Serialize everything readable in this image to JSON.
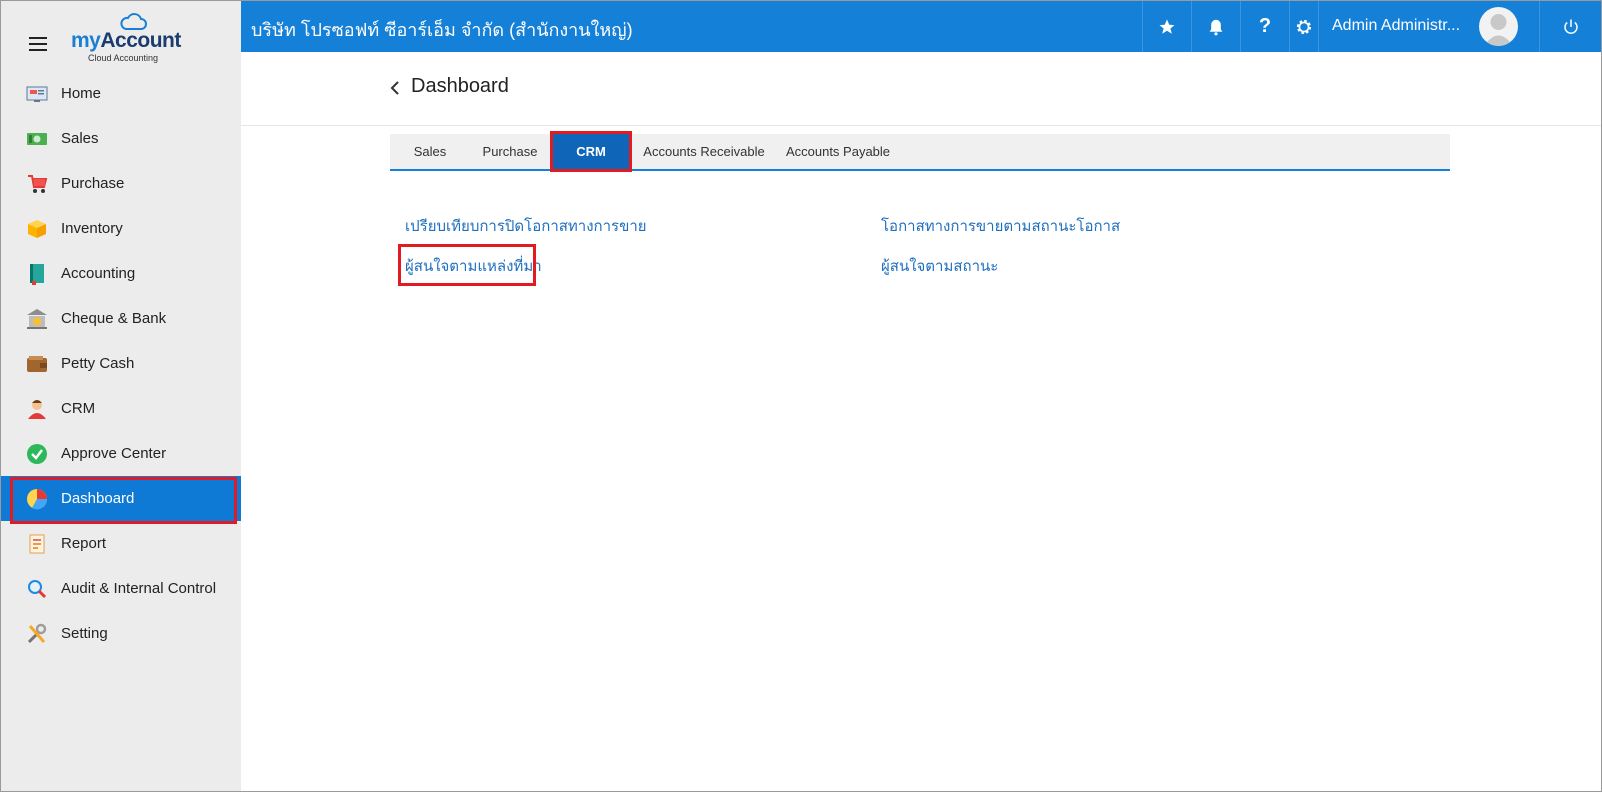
{
  "sidebar": {
    "logo_my": "my",
    "logo_account": "Account",
    "logo_sub": "Cloud Accounting",
    "items": [
      {
        "label": "Home",
        "icon": "home-icon"
      },
      {
        "label": "Sales",
        "icon": "sales-icon"
      },
      {
        "label": "Purchase",
        "icon": "cart-icon"
      },
      {
        "label": "Inventory",
        "icon": "box-icon"
      },
      {
        "label": "Accounting",
        "icon": "book-icon"
      },
      {
        "label": "Cheque & Bank",
        "icon": "bank-icon"
      },
      {
        "label": "Petty Cash",
        "icon": "wallet-icon"
      },
      {
        "label": "CRM",
        "icon": "person-icon"
      },
      {
        "label": "Approve Center",
        "icon": "check-circle-icon"
      },
      {
        "label": "Dashboard",
        "icon": "pie-chart-icon",
        "active": true
      },
      {
        "label": "Report",
        "icon": "report-icon"
      },
      {
        "label": "Audit & Internal Control",
        "icon": "magnifier-icon"
      },
      {
        "label": "Setting",
        "icon": "tools-icon"
      }
    ]
  },
  "topbar": {
    "company": "บริษัท โปรซอฟท์ ซีอาร์เอ็ม จำกัด (สำนักงานใหญ่)",
    "user_name": "Admin Administr...",
    "icons": [
      "star-icon",
      "bell-icon",
      "help-icon",
      "gear-icon",
      "power-icon"
    ],
    "help_glyph": "?"
  },
  "page": {
    "title": "Dashboard"
  },
  "tabs": [
    {
      "label": "Sales"
    },
    {
      "label": "Purchase"
    },
    {
      "label": "CRM",
      "active": true
    },
    {
      "label": "Accounts Receivable"
    },
    {
      "label": "Accounts Payable"
    }
  ],
  "reports": {
    "left": [
      "เปรียบเทียบการปิดโอกาสทางการขาย",
      "ผู้สนใจตามแหล่งที่มา"
    ],
    "right": [
      "โอกาสทางการขายตามสถานะโอกาส",
      "ผู้สนใจตามสถานะ"
    ]
  },
  "colors": {
    "topbar": "#1580d8",
    "active": "#0f7ad5",
    "highlight": "#e11b22",
    "link": "#1f6fbf"
  }
}
